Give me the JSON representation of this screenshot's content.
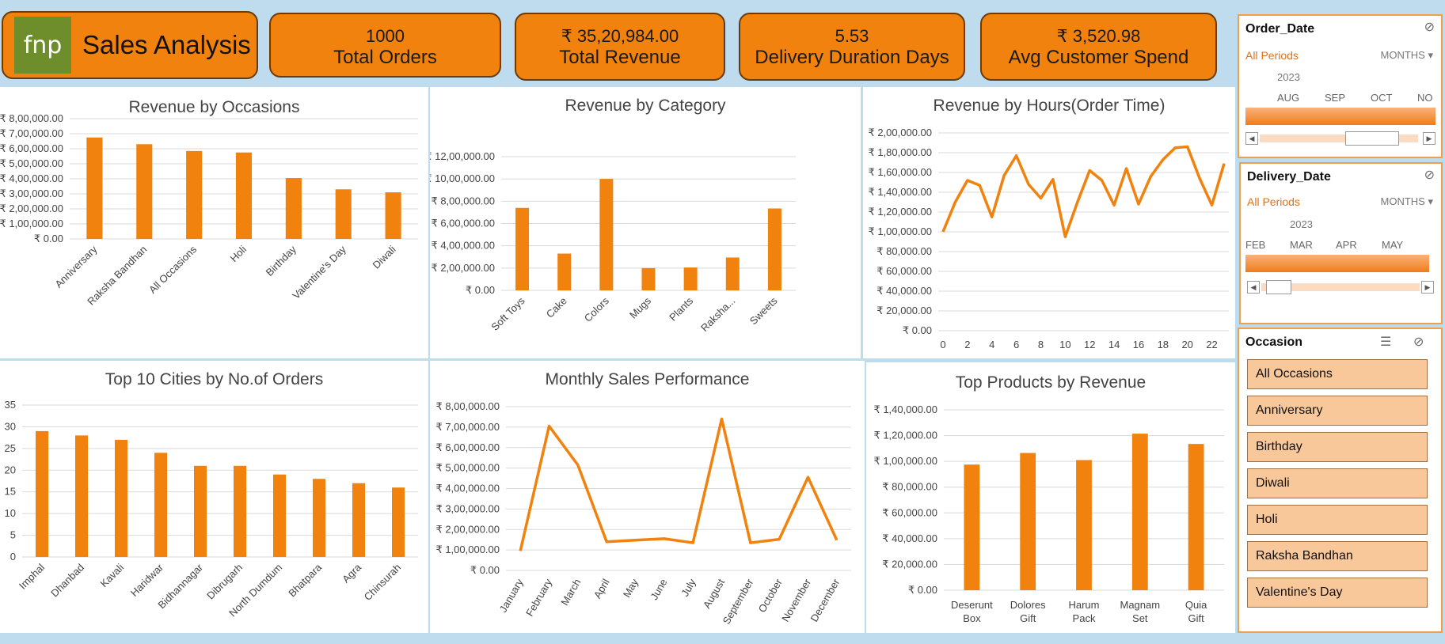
{
  "header": {
    "logo_text": "fnp",
    "title": "Sales Analysis"
  },
  "kpis": [
    {
      "value": "1000",
      "label": "Total Orders"
    },
    {
      "value": "₹ 35,20,984.00",
      "label": "Total Revenue"
    },
    {
      "value": "5.53",
      "label": "Delivery Duration Days"
    },
    {
      "value": "₹ 3,520.98",
      "label": "Avg Customer Spend"
    }
  ],
  "slicers": {
    "order_date": {
      "title": "Order_Date",
      "period": "All Periods",
      "unit": "MONTHS",
      "year": "2023",
      "months": [
        "AUG",
        "SEP",
        "OCT",
        "NO"
      ]
    },
    "delivery_date": {
      "title": "Delivery_Date",
      "period": "All Periods",
      "unit": "MONTHS",
      "year": "2023",
      "months": [
        "FEB",
        "MAR",
        "APR",
        "MAY"
      ]
    },
    "occasion": {
      "title": "Occasion",
      "items": [
        "All Occasions",
        "Anniversary",
        "Birthday",
        "Diwali",
        "Holi",
        "Raksha Bandhan",
        "Valentine's Day"
      ]
    }
  },
  "colors": {
    "bar": "#f0820d",
    "kpi": "#f0820d",
    "background": "#bfdcef"
  },
  "chart_data": [
    {
      "id": "occasions",
      "type": "bar",
      "title": "Revenue by Occasions",
      "categories": [
        "Anniversary",
        "Raksha Bandhan",
        "All Occasions",
        "Holi",
        "Birthday",
        "Valentine's Day",
        "Diwali"
      ],
      "values": [
        675000,
        630000,
        585000,
        575000,
        405000,
        330000,
        310000
      ],
      "ylim": [
        0,
        800000
      ],
      "yticks": [
        "₹ 0.00",
        "₹ 1,00,000.00",
        "₹ 2,00,000.00",
        "₹ 3,00,000.00",
        "₹ 4,00,000.00",
        "₹ 5,00,000.00",
        "₹ 6,00,000.00",
        "₹ 7,00,000.00",
        "₹ 8,00,000.00"
      ],
      "grid": true
    },
    {
      "id": "category",
      "type": "bar",
      "title": "Revenue by Category",
      "categories": [
        "Soft Toys",
        "Cake",
        "Colors",
        "Mugs",
        "Plants",
        "Raksha...",
        "Sweets"
      ],
      "values": [
        740000,
        330000,
        1000000,
        200000,
        205000,
        295000,
        735000
      ],
      "ylim": [
        0,
        1200000
      ],
      "yticks": [
        "₹ 0.00",
        "₹ 2,00,000.00",
        "₹ 4,00,000.00",
        "₹ 6,00,000.00",
        "₹ 8,00,000.00",
        "₹ 10,00,000.00",
        "₹ 12,00,000.00"
      ],
      "grid": true
    },
    {
      "id": "hours",
      "type": "line",
      "title": "Revenue by Hours(Order Time)",
      "x": [
        0,
        1,
        2,
        3,
        4,
        5,
        6,
        7,
        8,
        9,
        10,
        11,
        12,
        13,
        14,
        15,
        16,
        17,
        18,
        19,
        20,
        21,
        22,
        23
      ],
      "values": [
        100000,
        130000,
        152000,
        147000,
        115000,
        157000,
        177000,
        148000,
        134000,
        153000,
        95000,
        130000,
        162000,
        152000,
        127000,
        164000,
        128000,
        156000,
        173000,
        185000,
        186000,
        154000,
        127000,
        169000
      ],
      "ylim": [
        0,
        200000
      ],
      "xticks": [
        "0",
        "2",
        "4",
        "6",
        "8",
        "10",
        "12",
        "14",
        "16",
        "18",
        "20",
        "22"
      ],
      "yticks": [
        "₹ 0.00",
        "₹ 20,000.00",
        "₹ 40,000.00",
        "₹ 60,000.00",
        "₹ 80,000.00",
        "₹ 1,00,000.00",
        "₹ 1,20,000.00",
        "₹ 1,40,000.00",
        "₹ 1,60,000.00",
        "₹ 1,80,000.00",
        "₹ 2,00,000.00"
      ],
      "grid": true
    },
    {
      "id": "cities",
      "type": "bar",
      "title": "Top 10 Cities by No.of Orders",
      "categories": [
        "Imphal",
        "Dhanbad",
        "Kavali",
        "Haridwar",
        "Bidhannagar",
        "Dibrugarh",
        "North Dumdum",
        "Bhatpara",
        "Agra",
        "Chinsurah"
      ],
      "values": [
        29,
        28,
        27,
        24,
        21,
        21,
        19,
        18,
        17,
        16
      ],
      "ylim": [
        0,
        35
      ],
      "yticks": [
        "0",
        "5",
        "10",
        "15",
        "20",
        "25",
        "30",
        "35"
      ],
      "grid": true
    },
    {
      "id": "monthly",
      "type": "line",
      "title": "Monthly Sales Performance",
      "categories": [
        "January",
        "February",
        "March",
        "April",
        "May",
        "June",
        "July",
        "August",
        "September",
        "October",
        "November",
        "December"
      ],
      "values": [
        95000,
        705000,
        515000,
        140000,
        148000,
        155000,
        135000,
        740000,
        135000,
        152000,
        455000,
        148000
      ],
      "ylim": [
        0,
        800000
      ],
      "yticks": [
        "₹ 0.00",
        "₹ 1,00,000.00",
        "₹ 2,00,000.00",
        "₹ 3,00,000.00",
        "₹ 4,00,000.00",
        "₹ 5,00,000.00",
        "₹ 6,00,000.00",
        "₹ 7,00,000.00",
        "₹ 8,00,000.00"
      ],
      "grid": true
    },
    {
      "id": "products",
      "type": "bar",
      "title": "Top Products by Revenue",
      "categories": [
        "Deserunt Box",
        "Dolores Gift",
        "Harum Pack",
        "Magnam Set",
        "Quia Gift"
      ],
      "values": [
        97500,
        106500,
        101000,
        121500,
        113500
      ],
      "ylim": [
        0,
        140000
      ],
      "yticks": [
        "₹ 0.00",
        "₹ 20,000.00",
        "₹ 40,000.00",
        "₹ 60,000.00",
        "₹ 80,000.00",
        "₹ 1,00,000.00",
        "₹ 1,20,000.00",
        "₹ 1,40,000.00"
      ],
      "grid": true
    }
  ]
}
